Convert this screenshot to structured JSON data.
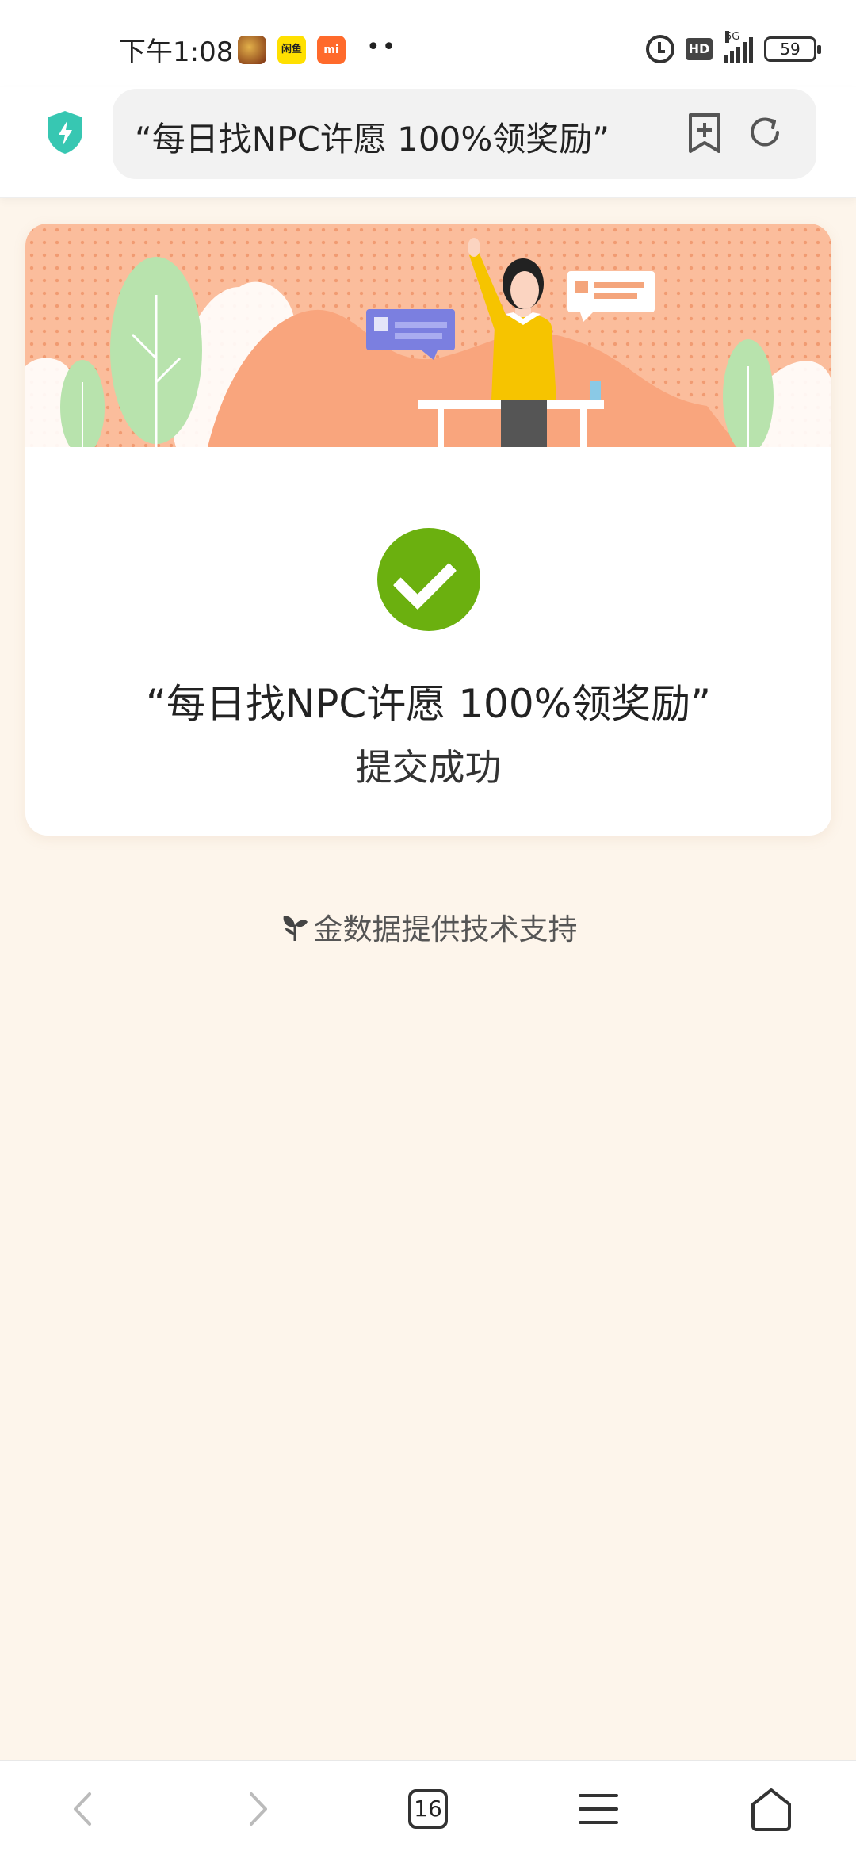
{
  "status_bar": {
    "time": "下午1:08",
    "notification_xianyu": "闲鱼",
    "notification_mi": "mi",
    "more": "••",
    "hd": "HD",
    "network": "5G",
    "battery": "59"
  },
  "browser": {
    "url_text": "“每日找NPC许愿 100%领奖励”"
  },
  "card": {
    "title": "“每日找NPC许愿 100%领奖励”",
    "subtitle": "提交成功"
  },
  "credit": {
    "text": "金数据提供技术支持"
  },
  "bottom_nav": {
    "tab_count": "16"
  },
  "colors": {
    "success": "#6bb00f",
    "banner": "#fbbd9c",
    "page_bg": "#fdf5eb"
  }
}
